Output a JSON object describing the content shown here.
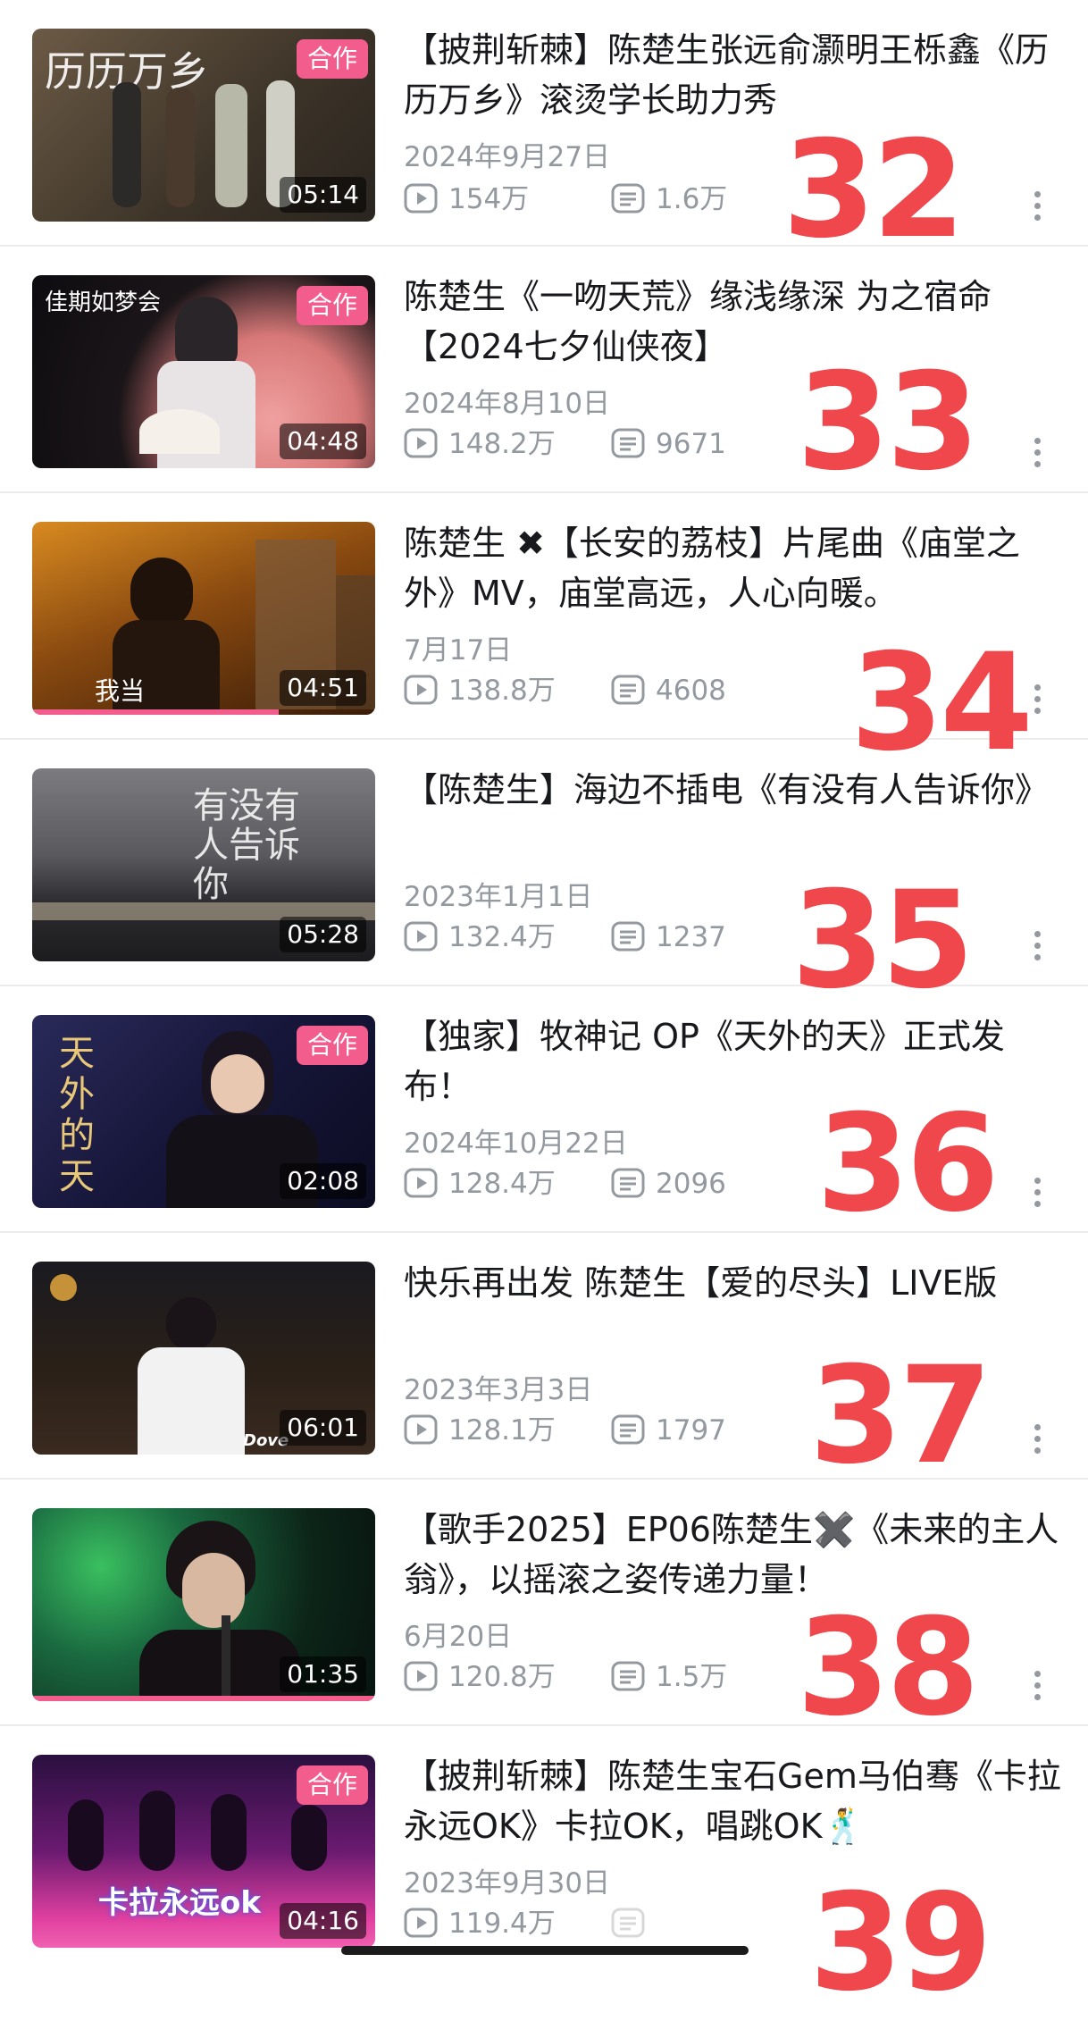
{
  "ui": {
    "badge_label": "合作",
    "accent": "#f25d8e",
    "number_color": "#f0474c"
  },
  "videos": [
    {
      "title": "【披荆斩棘】陈楚生张远俞灏明王栎鑫《历历万乡》滚烫学长助力秀",
      "date": "2024年9月27日",
      "views": "154万",
      "comments": "1.6万",
      "duration": "05:14",
      "rank": "32",
      "badge": true,
      "thumb_text": "历历万乡"
    },
    {
      "title": "陈楚生《一吻天荒》缘浅缘深 为之宿命【2024七夕仙侠夜】",
      "date": "2024年8月10日",
      "views": "148.2万",
      "comments": "9671",
      "duration": "04:48",
      "rank": "33",
      "badge": true,
      "thumb_text": "佳期如梦会"
    },
    {
      "title": "陈楚生 ✖【长安的荔枝】片尾曲《庙堂之外》MV，庙堂高远，人心向暖。",
      "date": "7月17日",
      "views": "138.8万",
      "comments": "4608",
      "duration": "04:51",
      "rank": "34",
      "badge": false,
      "progress": 0.72,
      "thumb_text": "我当"
    },
    {
      "title": "【陈楚生】海边不插电《有没有人告诉你》",
      "date": "2023年1月1日",
      "views": "132.4万",
      "comments": "1237",
      "duration": "05:28",
      "rank": "35",
      "badge": false,
      "thumb_text": "有没有人告诉你"
    },
    {
      "title": "【独家】牧神记 OP《天外的天》正式发布！",
      "date": "2024年10月22日",
      "views": "128.4万",
      "comments": "2096",
      "duration": "02:08",
      "rank": "36",
      "badge": true,
      "thumb_text": "天外的天"
    },
    {
      "title": "快乐再出发 陈楚生【爱的尽头】LIVE版",
      "date": "2023年3月3日",
      "views": "128.1万",
      "comments": "1797",
      "duration": "06:01",
      "rank": "37",
      "badge": false,
      "thumb_text": "Dove"
    },
    {
      "title": "【歌手2025】EP06陈楚生✖️《未来的主人翁》，以摇滚之姿传递力量！",
      "date": "6月20日",
      "views": "120.8万",
      "comments": "1.5万",
      "duration": "01:35",
      "rank": "38",
      "badge": false,
      "progress": 1.0,
      "thumb_text": ""
    },
    {
      "title": "【披荆斩棘】陈楚生宝石Gem马伯骞《卡拉永远OK》卡拉OK，唱跳OK🕺",
      "date": "2023年9月30日",
      "views": "119.4万",
      "comments": "",
      "duration": "04:16",
      "rank": "39",
      "badge": true,
      "thumb_text": "卡拉永远ok"
    }
  ]
}
